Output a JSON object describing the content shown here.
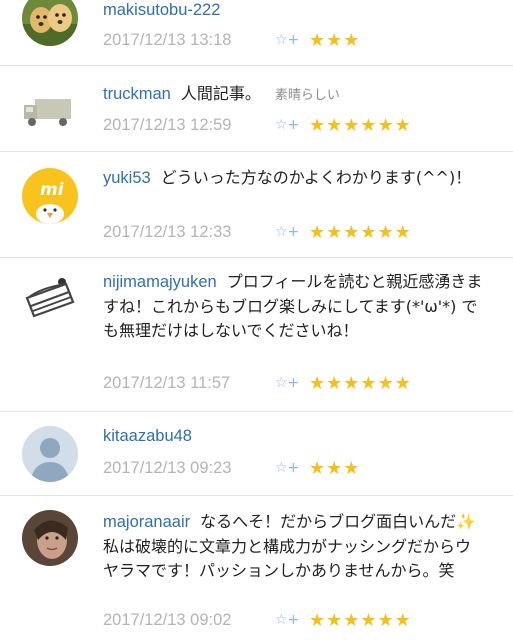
{
  "comments": [
    {
      "user": "makisutobu-222",
      "text": "",
      "tag": "",
      "date": "2017/12/13 13:18",
      "stars": 3
    },
    {
      "user": "truckman",
      "text": "人間記事。",
      "tag": "素晴らしい",
      "date": "2017/12/13 12:59",
      "stars": 6
    },
    {
      "user": "yuki53",
      "text": "どういった方なのかよくわかります(^^)！",
      "tag": "",
      "date": "2017/12/13 12:33",
      "stars": 6
    },
    {
      "user": "nijimamajyuken",
      "text": "プロフィールを読むと親近感湧きますね！これからもブログ楽しみにしてます(*'ω'*) でも無理だけはしないでくださいね！",
      "tag": "",
      "date": "2017/12/13 11:57",
      "stars": 6
    },
    {
      "user": "kitaazabu48",
      "text": "",
      "tag": "",
      "date": "2017/12/13 09:23",
      "stars": 3
    },
    {
      "user": "majoranaair",
      "text": "なるへそ！だからブログ面白いんだ✨私は破壊的に文章力と構成力がナッシングだからウヤラマです！パッションしかありませんから。笑",
      "tag": "",
      "date": "2017/12/13 09:02",
      "stars": 6
    }
  ],
  "add_star_glyph": "☆+",
  "colors": {
    "username": "#2f6fb3",
    "date": "#b4b4b4",
    "star": "#f5bf1c",
    "add_star": "#8bb7e6",
    "divider": "#e3e3e3"
  },
  "icons": [
    "dog-photo-avatar-icon",
    "truck-avatar-icon",
    "mi-chick-avatar-icon",
    "cake-avatar-icon",
    "default-person-avatar-icon",
    "portrait-photo-avatar-icon"
  ]
}
